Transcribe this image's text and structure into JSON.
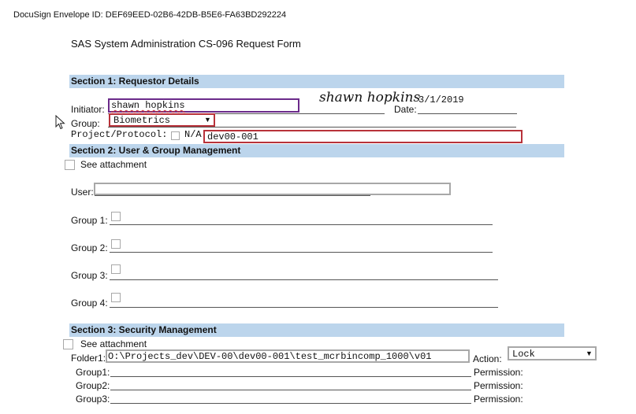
{
  "envelope_id": "DocuSign Envelope ID: DEF69EED-02B6-42DB-B5E6-FA63BD292224",
  "form_title": "SAS System Administration CS-096 Request Form",
  "section1": {
    "title": "Section 1: Requestor Details",
    "initiator_label": "Initiator:",
    "initiator_value": "shawn hopkins",
    "signature": "shawn hopkins",
    "date_label": "Date:",
    "date_value": "3/1/2019",
    "group_label": "Group:",
    "group_value": "Biometrics",
    "project_label": "Project/Protocol:",
    "na_label": "N/A",
    "project_value": "dev00-001"
  },
  "section2": {
    "title": "Section 2: User & Group Management",
    "see_attachment": "See attachment",
    "user_label": "User:",
    "groups": [
      {
        "label": "Group 1:"
      },
      {
        "label": "Group 2:"
      },
      {
        "label": "Group 3:"
      },
      {
        "label": "Group 4:"
      }
    ]
  },
  "section3": {
    "title": "Section 3: Security Management",
    "see_attachment": "See attachment",
    "folder_label": "Folder1:",
    "folder_value": "O:\\Projects_dev\\DEV-00\\dev00-001\\test_mcrbincomp_1000\\v01",
    "action_label": "Action:",
    "action_value": "Lock",
    "rows": [
      {
        "label": "Group1:",
        "permission_label": "Permission:"
      },
      {
        "label": "Group2:",
        "permission_label": "Permission:"
      },
      {
        "label": "Group3:",
        "permission_label": "Permission:"
      }
    ]
  },
  "colors": {
    "section_bar": "#bcd5ec",
    "field_border_red": "#b8323a",
    "field_border_purple": "#6b2a8a",
    "field_border_gray": "#a8a8a8"
  },
  "icons": {
    "cursor": "mouse-pointer-icon",
    "dropdown": "triangle-down-icon"
  }
}
